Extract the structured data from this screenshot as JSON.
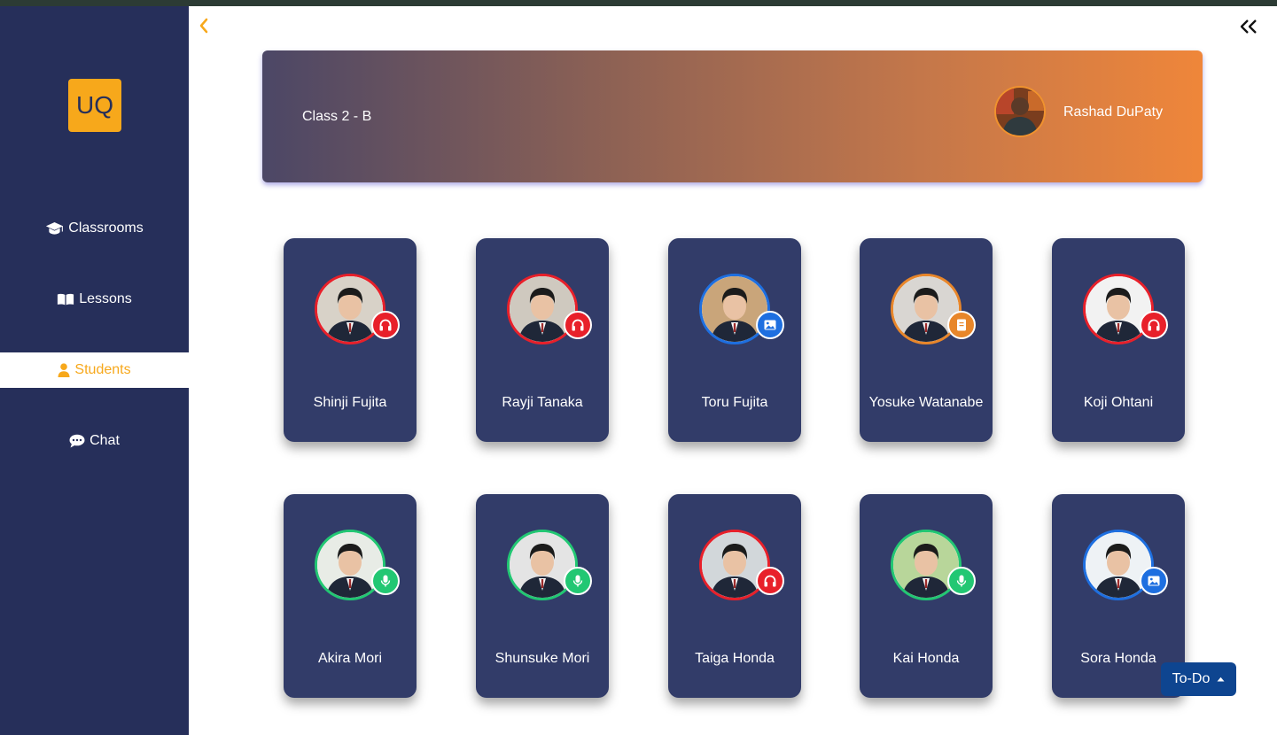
{
  "app": {
    "logo_text": "UQ"
  },
  "sidebar": {
    "items": [
      {
        "label": "Classrooms",
        "icon": "graduation-cap-icon",
        "active": false
      },
      {
        "label": "Lessons",
        "icon": "book-icon",
        "active": false
      },
      {
        "label": "Students",
        "icon": "user-icon",
        "active": true
      },
      {
        "label": "Chat",
        "icon": "speech-bubble-icon",
        "active": false
      }
    ]
  },
  "banner": {
    "class_name": "Class 2 - B",
    "teacher_name": "Rashad DuPaty"
  },
  "students": [
    {
      "name": "Shinji Fujita",
      "status": "headphones",
      "ring_color": "#e8202a",
      "badge_color": "#e8202a"
    },
    {
      "name": "Rayji Tanaka",
      "status": "headphones",
      "ring_color": "#e8202a",
      "badge_color": "#e8202a"
    },
    {
      "name": "Toru Fujita",
      "status": "image",
      "ring_color": "#1e6fe0",
      "badge_color": "#1e6fe0"
    },
    {
      "name": "Yosuke Watanabe",
      "status": "book",
      "ring_color": "#e8862a",
      "badge_color": "#e8862a"
    },
    {
      "name": "Koji Ohtani",
      "status": "headphones",
      "ring_color": "#e8202a",
      "badge_color": "#e8202a"
    },
    {
      "name": "Akira Mori",
      "status": "microphone",
      "ring_color": "#22c773",
      "badge_color": "#22c773"
    },
    {
      "name": "Shunsuke Mori",
      "status": "microphone",
      "ring_color": "#22c773",
      "badge_color": "#22c773"
    },
    {
      "name": "Taiga Honda",
      "status": "headphones",
      "ring_color": "#e8202a",
      "badge_color": "#e8202a"
    },
    {
      "name": "Kai Honda",
      "status": "microphone",
      "ring_color": "#22c773",
      "badge_color": "#22c773"
    },
    {
      "name": "Sora Honda",
      "status": "image",
      "ring_color": "#1e6fe0",
      "badge_color": "#1e6fe0"
    }
  ],
  "todo": {
    "label": "To-Do"
  },
  "colors": {
    "sidebar": "#262f5a",
    "card": "#323c69",
    "accent": "#f7a81b",
    "todo_button": "#0e4590"
  }
}
